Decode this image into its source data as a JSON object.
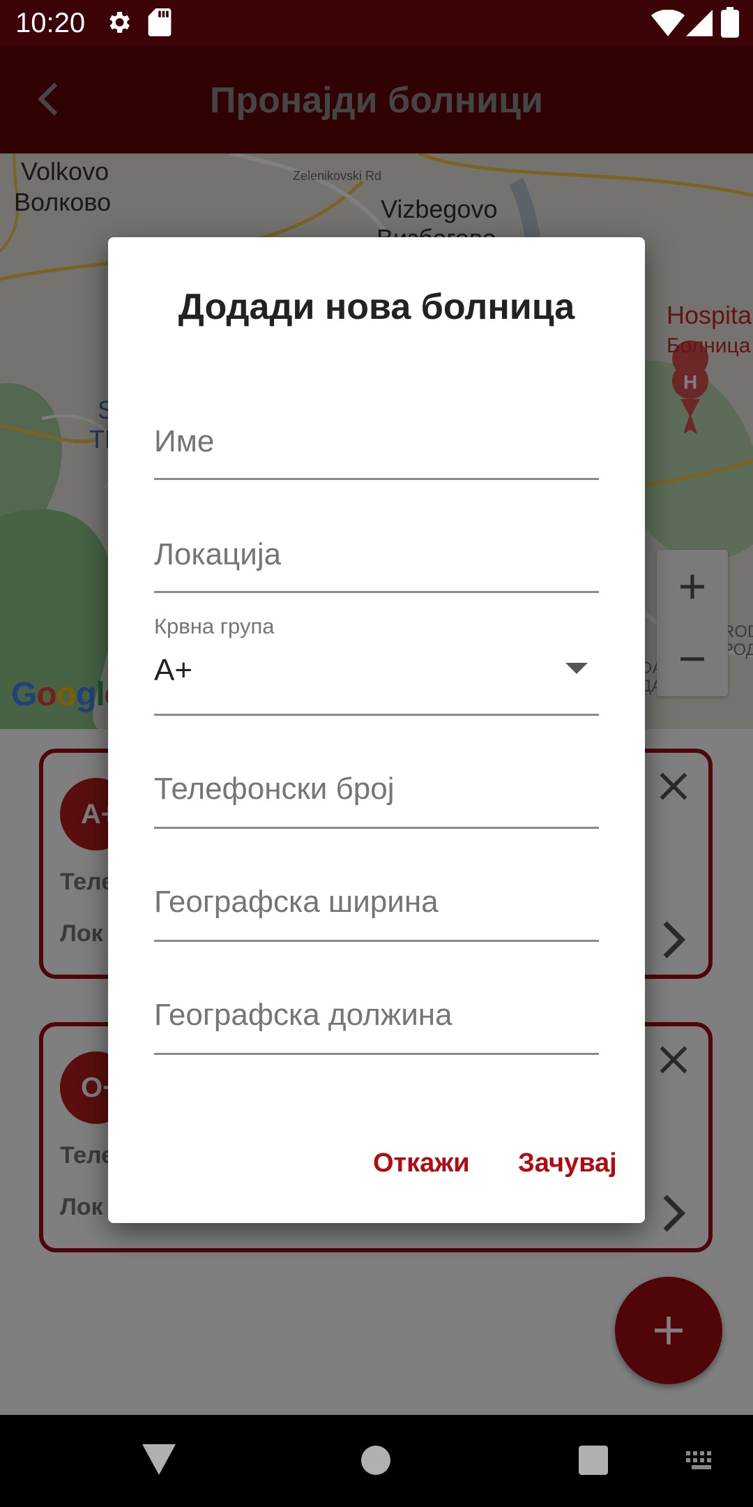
{
  "status_bar": {
    "time": "10:20",
    "icons": [
      "gear-icon",
      "sd-card-icon",
      "wifi-icon",
      "signal-icon",
      "battery-icon"
    ]
  },
  "app_bar": {
    "title": "Пронајди болници",
    "back_icon": "back-arrow-icon"
  },
  "map": {
    "labels": {
      "volkovo_latin": "Volkovo",
      "volkovo_cyrillic": "Волково",
      "vizbegovo_latin": "Vizbegovo",
      "vizbegovo_cyrillic": "Визбегово",
      "hospital_latin": "Hospita",
      "hospital_cyrillic": "Болница",
      "road": "Zelenikovski Rd",
      "left_edge_1": "S",
      "left_edge_2": "TL",
      "aerodrom_1": "AEROD",
      "aerodrom_2": "АЕРОД",
      "da_1": "DA",
      "da_2": "ДА"
    },
    "zoom_in": "+",
    "zoom_out": "−",
    "logo": "Google"
  },
  "cards": [
    {
      "badge": "A+",
      "line1": "Теле",
      "line2": "Лок"
    },
    {
      "badge": "O+",
      "line1": "Теле",
      "line2": "Лок"
    }
  ],
  "fab": {
    "icon": "plus-icon"
  },
  "dialog": {
    "title": "Додади нова болница",
    "fields": {
      "name_placeholder": "Име",
      "location_placeholder": "Локација",
      "blood_group_label": "Крвна група",
      "blood_group_value": "A+",
      "phone_placeholder": "Телефонски број",
      "latitude_placeholder": "Географска ширина",
      "longitude_placeholder": "Географска должина"
    },
    "cancel_label": "Откажи",
    "save_label": "Зачувај"
  },
  "colors": {
    "primary": "#600409",
    "accent": "#b3090f",
    "status_bar": "#3d0408"
  }
}
